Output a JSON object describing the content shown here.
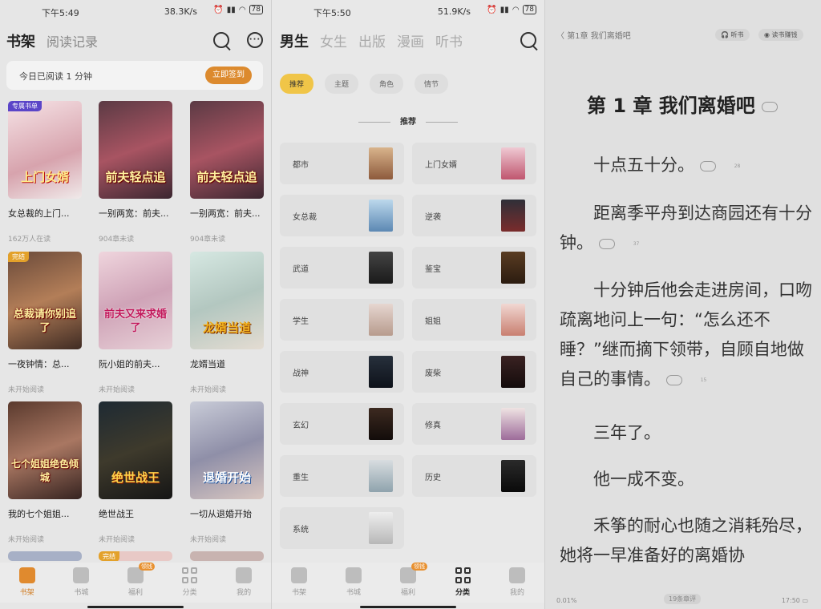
{
  "panel1": {
    "status": {
      "time": "下午5:49",
      "speed": "38.3K/s",
      "battery": "78"
    },
    "tabs": [
      "书架",
      "阅读记录"
    ],
    "signin": {
      "text": "今日已阅读 1 分钟",
      "button": "立即签到"
    },
    "books": [
      {
        "name": "女总裁的上门...",
        "sub": "162万人在读",
        "tag": "专属书单",
        "cover_title": "上门女婿"
      },
      {
        "name": "一别两宽：前夫...",
        "sub": "904章未读",
        "tag": "",
        "cover_title": "前夫轻点追"
      },
      {
        "name": "一别两宽：前夫...",
        "sub": "904章未读",
        "tag": "",
        "cover_title": "前夫轻点追"
      },
      {
        "name": "一夜钟情：总...",
        "sub": "未开始阅读",
        "tag": "完结",
        "cover_title": "总裁请你别追了"
      },
      {
        "name": "阮小姐的前夫...",
        "sub": "未开始阅读",
        "tag": "",
        "cover_title": "前夫又来求婚了"
      },
      {
        "name": "龙婿当道",
        "sub": "未开始阅读",
        "tag": "",
        "cover_title": "龙婿当道"
      },
      {
        "name": "我的七个姐姐...",
        "sub": "未开始阅读",
        "tag": "",
        "cover_title": "七个姐姐绝色倾城"
      },
      {
        "name": "绝世战王",
        "sub": "未开始阅读",
        "tag": "",
        "cover_title": "绝世战王"
      },
      {
        "name": "一切从退婚开始",
        "sub": "未开始阅读",
        "tag": "",
        "cover_title": "退婚开始"
      }
    ],
    "partial_tag": "完结",
    "nav": [
      {
        "label": "书架",
        "badge": ""
      },
      {
        "label": "书城",
        "badge": ""
      },
      {
        "label": "福利",
        "badge": "领钱"
      },
      {
        "label": "分类",
        "badge": ""
      },
      {
        "label": "我的",
        "badge": ""
      }
    ]
  },
  "panel2": {
    "status": {
      "time": "下午5:50",
      "speed": "51.9K/s",
      "battery": "78"
    },
    "tabs": [
      "男生",
      "女生",
      "出版",
      "漫画",
      "听书"
    ],
    "chips": [
      "推荐",
      "主题",
      "角色",
      "情节"
    ],
    "section": "推荐",
    "categories": [
      "都市",
      "上门女婿",
      "女总裁",
      "逆袭",
      "武道",
      "鉴宝",
      "学生",
      "姐姐",
      "战神",
      "废柴",
      "玄幻",
      "修真",
      "重生",
      "历史",
      "系统"
    ],
    "nav": [
      {
        "label": "书架",
        "badge": ""
      },
      {
        "label": "书城",
        "badge": ""
      },
      {
        "label": "福利",
        "badge": "领钱"
      },
      {
        "label": "分类",
        "badge": ""
      },
      {
        "label": "我的",
        "badge": ""
      }
    ]
  },
  "panel3": {
    "header": "第1章 我们离婚吧",
    "listen": "听书",
    "earn": "读书赚钱",
    "chapter_title": "第 1 章  我们离婚吧",
    "title_comments": "",
    "paragraphs": [
      {
        "text": "十点五十分。",
        "comments": "28"
      },
      {
        "text": "距离季平舟到达商园还有十分钟。",
        "comments": "37"
      },
      {
        "text": "十分钟后他会走进房间，口吻疏离地问上一句：“怎么还不睡？”继而摘下领带，自顾自地做自己的事情。",
        "comments": "15"
      },
      {
        "text": "三年了。",
        "comments": ""
      },
      {
        "text": "他一成不变。",
        "comments": ""
      },
      {
        "text": "禾筝的耐心也随之消耗殆尽，她将一早准备好的离婚协",
        "comments": ""
      }
    ],
    "footer": {
      "progress": "0.01%",
      "comments": "19条章评",
      "time": "17:50"
    }
  },
  "colors": {
    "accent": "#e08a2e",
    "chip_active": "#f0c548"
  }
}
